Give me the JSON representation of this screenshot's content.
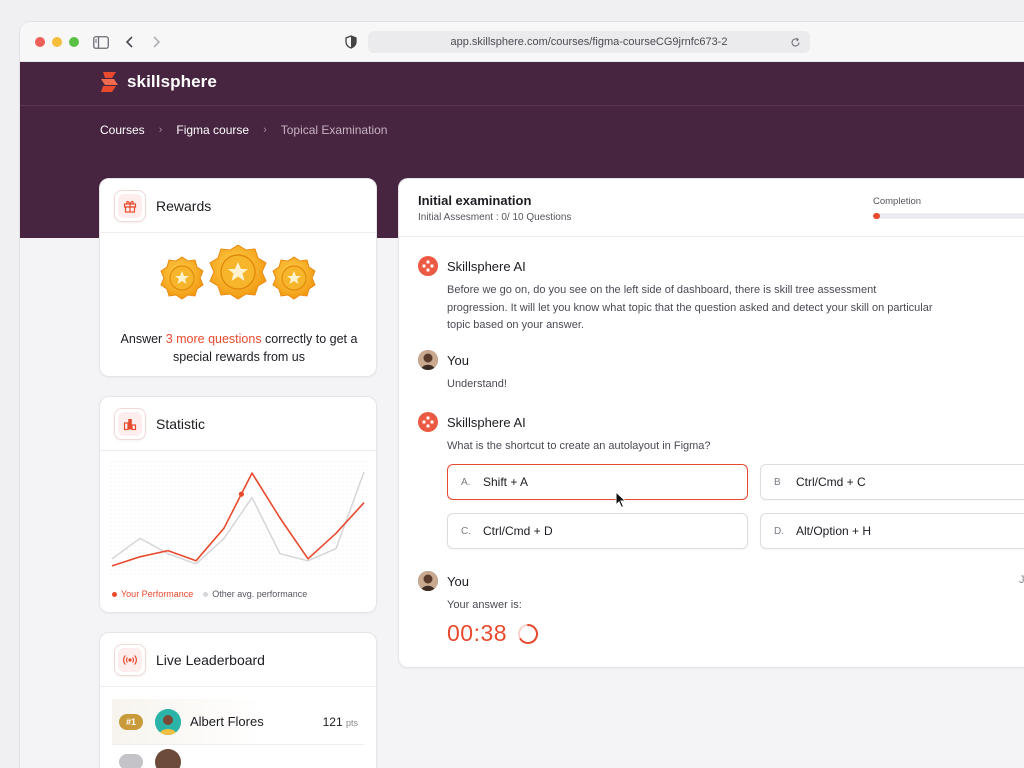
{
  "browser": {
    "url": "app.skillsphere.com/courses/figma-courseCG9jrnfc673-2"
  },
  "brand": {
    "name": "skillsphere",
    "accent": "#e84a2e",
    "header_bg": "#47243f"
  },
  "breadcrumb": {
    "items": [
      "Courses",
      "Figma course",
      "Topical Examination"
    ]
  },
  "rewards": {
    "title": "Rewards",
    "text_before": "Answer ",
    "highlight": "3 more questions",
    "text_after": " correctly to get a special rewards from us"
  },
  "statistic": {
    "title": "Statistic",
    "legend_you": "Your Performance",
    "legend_other": "Other avg. performance"
  },
  "chart_data": {
    "type": "line",
    "title": "",
    "xlabel": "",
    "ylabel": "",
    "ylim": [
      0,
      100
    ],
    "x": [
      0,
      1,
      2,
      3,
      4,
      5,
      6,
      7,
      8,
      9
    ],
    "series": [
      {
        "name": "Your Performance",
        "color": "#e84a2e",
        "values": [
          3,
          12,
          18,
          8,
          40,
          94,
          50,
          10,
          35,
          65
        ]
      },
      {
        "name": "Other avg. performance",
        "color": "#d6d6da",
        "values": [
          10,
          30,
          15,
          5,
          30,
          70,
          15,
          8,
          20,
          95
        ]
      }
    ]
  },
  "leaderboard": {
    "title": "Live Leaderboard",
    "rows": [
      {
        "rank": "#1",
        "name": "Albert Flores",
        "points": "121",
        "unit": "pts"
      }
    ]
  },
  "exam": {
    "title": "Initial examination",
    "subtitle": "Initial Assesment : 0/ 10 Questions",
    "completion_label": "Completion",
    "completion_progress": 0.04,
    "messages": [
      {
        "author": "Skillsphere AI",
        "text": "Before we go on, do you see on the left side of dashboard, there is skill tree assessment progression. It will let you know what topic that the question asked and detect your skill on particular topic based on your answer."
      },
      {
        "author": "You",
        "text": "Understand!"
      },
      {
        "author": "Skillsphere AI",
        "text": "What is the shortcut to create an autolayout in Figma?"
      },
      {
        "author": "You",
        "text": "Your answer is:"
      }
    ],
    "options": [
      {
        "key": "A.",
        "label": "Shift + A",
        "selected": true
      },
      {
        "key": "B",
        "label": "Ctrl/Cmd + C",
        "selected": false
      },
      {
        "key": "C.",
        "label": "Ctrl/Cmd + D",
        "selected": false
      },
      {
        "key": "D.",
        "label": "Alt/Option + H",
        "selected": false
      }
    ],
    "timer": "00:38",
    "edge_text": "J"
  }
}
